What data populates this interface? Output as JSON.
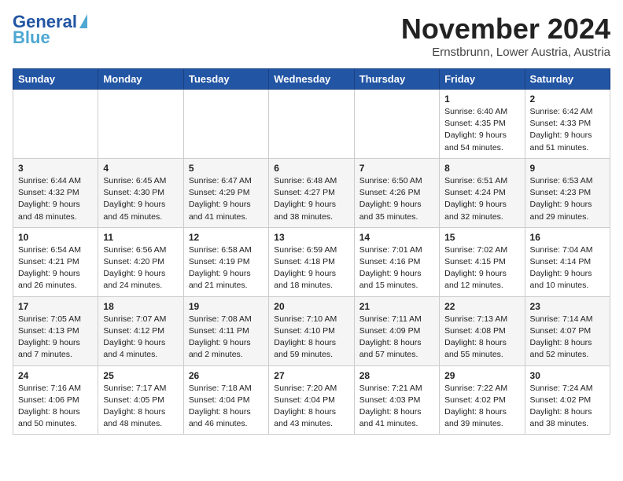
{
  "logo": {
    "line1": "General",
    "line2": "Blue"
  },
  "header": {
    "month": "November 2024",
    "location": "Ernstbrunn, Lower Austria, Austria"
  },
  "weekdays": [
    "Sunday",
    "Monday",
    "Tuesday",
    "Wednesday",
    "Thursday",
    "Friday",
    "Saturday"
  ],
  "weeks": [
    [
      {
        "day": "",
        "info": ""
      },
      {
        "day": "",
        "info": ""
      },
      {
        "day": "",
        "info": ""
      },
      {
        "day": "",
        "info": ""
      },
      {
        "day": "",
        "info": ""
      },
      {
        "day": "1",
        "info": "Sunrise: 6:40 AM\nSunset: 4:35 PM\nDaylight: 9 hours\nand 54 minutes."
      },
      {
        "day": "2",
        "info": "Sunrise: 6:42 AM\nSunset: 4:33 PM\nDaylight: 9 hours\nand 51 minutes."
      }
    ],
    [
      {
        "day": "3",
        "info": "Sunrise: 6:44 AM\nSunset: 4:32 PM\nDaylight: 9 hours\nand 48 minutes."
      },
      {
        "day": "4",
        "info": "Sunrise: 6:45 AM\nSunset: 4:30 PM\nDaylight: 9 hours\nand 45 minutes."
      },
      {
        "day": "5",
        "info": "Sunrise: 6:47 AM\nSunset: 4:29 PM\nDaylight: 9 hours\nand 41 minutes."
      },
      {
        "day": "6",
        "info": "Sunrise: 6:48 AM\nSunset: 4:27 PM\nDaylight: 9 hours\nand 38 minutes."
      },
      {
        "day": "7",
        "info": "Sunrise: 6:50 AM\nSunset: 4:26 PM\nDaylight: 9 hours\nand 35 minutes."
      },
      {
        "day": "8",
        "info": "Sunrise: 6:51 AM\nSunset: 4:24 PM\nDaylight: 9 hours\nand 32 minutes."
      },
      {
        "day": "9",
        "info": "Sunrise: 6:53 AM\nSunset: 4:23 PM\nDaylight: 9 hours\nand 29 minutes."
      }
    ],
    [
      {
        "day": "10",
        "info": "Sunrise: 6:54 AM\nSunset: 4:21 PM\nDaylight: 9 hours\nand 26 minutes."
      },
      {
        "day": "11",
        "info": "Sunrise: 6:56 AM\nSunset: 4:20 PM\nDaylight: 9 hours\nand 24 minutes."
      },
      {
        "day": "12",
        "info": "Sunrise: 6:58 AM\nSunset: 4:19 PM\nDaylight: 9 hours\nand 21 minutes."
      },
      {
        "day": "13",
        "info": "Sunrise: 6:59 AM\nSunset: 4:18 PM\nDaylight: 9 hours\nand 18 minutes."
      },
      {
        "day": "14",
        "info": "Sunrise: 7:01 AM\nSunset: 4:16 PM\nDaylight: 9 hours\nand 15 minutes."
      },
      {
        "day": "15",
        "info": "Sunrise: 7:02 AM\nSunset: 4:15 PM\nDaylight: 9 hours\nand 12 minutes."
      },
      {
        "day": "16",
        "info": "Sunrise: 7:04 AM\nSunset: 4:14 PM\nDaylight: 9 hours\nand 10 minutes."
      }
    ],
    [
      {
        "day": "17",
        "info": "Sunrise: 7:05 AM\nSunset: 4:13 PM\nDaylight: 9 hours\nand 7 minutes."
      },
      {
        "day": "18",
        "info": "Sunrise: 7:07 AM\nSunset: 4:12 PM\nDaylight: 9 hours\nand 4 minutes."
      },
      {
        "day": "19",
        "info": "Sunrise: 7:08 AM\nSunset: 4:11 PM\nDaylight: 9 hours\nand 2 minutes."
      },
      {
        "day": "20",
        "info": "Sunrise: 7:10 AM\nSunset: 4:10 PM\nDaylight: 8 hours\nand 59 minutes."
      },
      {
        "day": "21",
        "info": "Sunrise: 7:11 AM\nSunset: 4:09 PM\nDaylight: 8 hours\nand 57 minutes."
      },
      {
        "day": "22",
        "info": "Sunrise: 7:13 AM\nSunset: 4:08 PM\nDaylight: 8 hours\nand 55 minutes."
      },
      {
        "day": "23",
        "info": "Sunrise: 7:14 AM\nSunset: 4:07 PM\nDaylight: 8 hours\nand 52 minutes."
      }
    ],
    [
      {
        "day": "24",
        "info": "Sunrise: 7:16 AM\nSunset: 4:06 PM\nDaylight: 8 hours\nand 50 minutes."
      },
      {
        "day": "25",
        "info": "Sunrise: 7:17 AM\nSunset: 4:05 PM\nDaylight: 8 hours\nand 48 minutes."
      },
      {
        "day": "26",
        "info": "Sunrise: 7:18 AM\nSunset: 4:04 PM\nDaylight: 8 hours\nand 46 minutes."
      },
      {
        "day": "27",
        "info": "Sunrise: 7:20 AM\nSunset: 4:04 PM\nDaylight: 8 hours\nand 43 minutes."
      },
      {
        "day": "28",
        "info": "Sunrise: 7:21 AM\nSunset: 4:03 PM\nDaylight: 8 hours\nand 41 minutes."
      },
      {
        "day": "29",
        "info": "Sunrise: 7:22 AM\nSunset: 4:02 PM\nDaylight: 8 hours\nand 39 minutes."
      },
      {
        "day": "30",
        "info": "Sunrise: 7:24 AM\nSunset: 4:02 PM\nDaylight: 8 hours\nand 38 minutes."
      }
    ]
  ]
}
